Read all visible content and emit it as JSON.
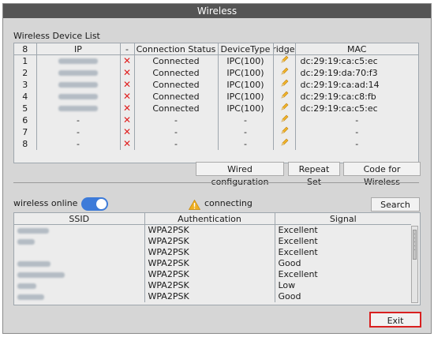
{
  "window": {
    "title": "Wireless"
  },
  "device_list": {
    "title": "Wireless Device List",
    "columns": [
      "8",
      "IP",
      "-",
      "Connection Status",
      "DeviceType",
      "Bridge",
      "MAC"
    ],
    "rows": [
      {
        "index": "1",
        "ip_hidden": true,
        "status": "Connected",
        "type": "IPC(100)",
        "mac": "dc:29:19:ca:c5:ec"
      },
      {
        "index": "2",
        "ip_hidden": true,
        "status": "Connected",
        "type": "IPC(100)",
        "mac": "dc:29:19:da:70:f3"
      },
      {
        "index": "3",
        "ip_hidden": true,
        "status": "Connected",
        "type": "IPC(100)",
        "mac": "dc:29:19:ca:ad:14"
      },
      {
        "index": "4",
        "ip_hidden": true,
        "status": "Connected",
        "type": "IPC(100)",
        "mac": "dc:29:19:ca:c8:fb"
      },
      {
        "index": "5",
        "ip_hidden": true,
        "status": "Connected",
        "type": "IPC(100)",
        "mac": "dc:29:19:ca:c5:ec"
      },
      {
        "index": "6",
        "ip": "-",
        "status": "-",
        "type": "-",
        "mac": "-"
      },
      {
        "index": "7",
        "ip": "-",
        "status": "-",
        "type": "-",
        "mac": "-"
      },
      {
        "index": "8",
        "ip": "-",
        "status": "-",
        "type": "-",
        "mac": "-"
      }
    ],
    "icons": {
      "delete": "close-x-icon",
      "bridge": "pencil-icon"
    },
    "colors": {
      "delete": "#e02020",
      "bridge": "#f0b42a"
    }
  },
  "actions": {
    "wired_configuration": "Wired configuration",
    "repeat_set": "Repeat Set",
    "code_for_wireless": "Code for Wireless"
  },
  "wireless_online": {
    "label": "wireless online",
    "toggle_on": true,
    "toggle_color": "#3d7bd9",
    "status": "connecting",
    "status_icon": "warning-icon",
    "search": "Search"
  },
  "networks": {
    "columns": [
      "SSID",
      "Authentication",
      "Signal"
    ],
    "rows": [
      {
        "auth": "WPA2PSK",
        "signal": "Excellent"
      },
      {
        "auth": "WPA2PSK",
        "signal": "Excellent"
      },
      {
        "auth": "WPA2PSK",
        "signal": "Excellent"
      },
      {
        "auth": "WPA2PSK",
        "signal": "Good"
      },
      {
        "auth": "WPA2PSK",
        "signal": "Excellent"
      },
      {
        "auth": "WPA2PSK",
        "signal": "Low"
      },
      {
        "auth": "WPA2PSK",
        "signal": "Good"
      }
    ]
  },
  "exit": {
    "label": "Exit",
    "highlight_color": "#d92020"
  }
}
